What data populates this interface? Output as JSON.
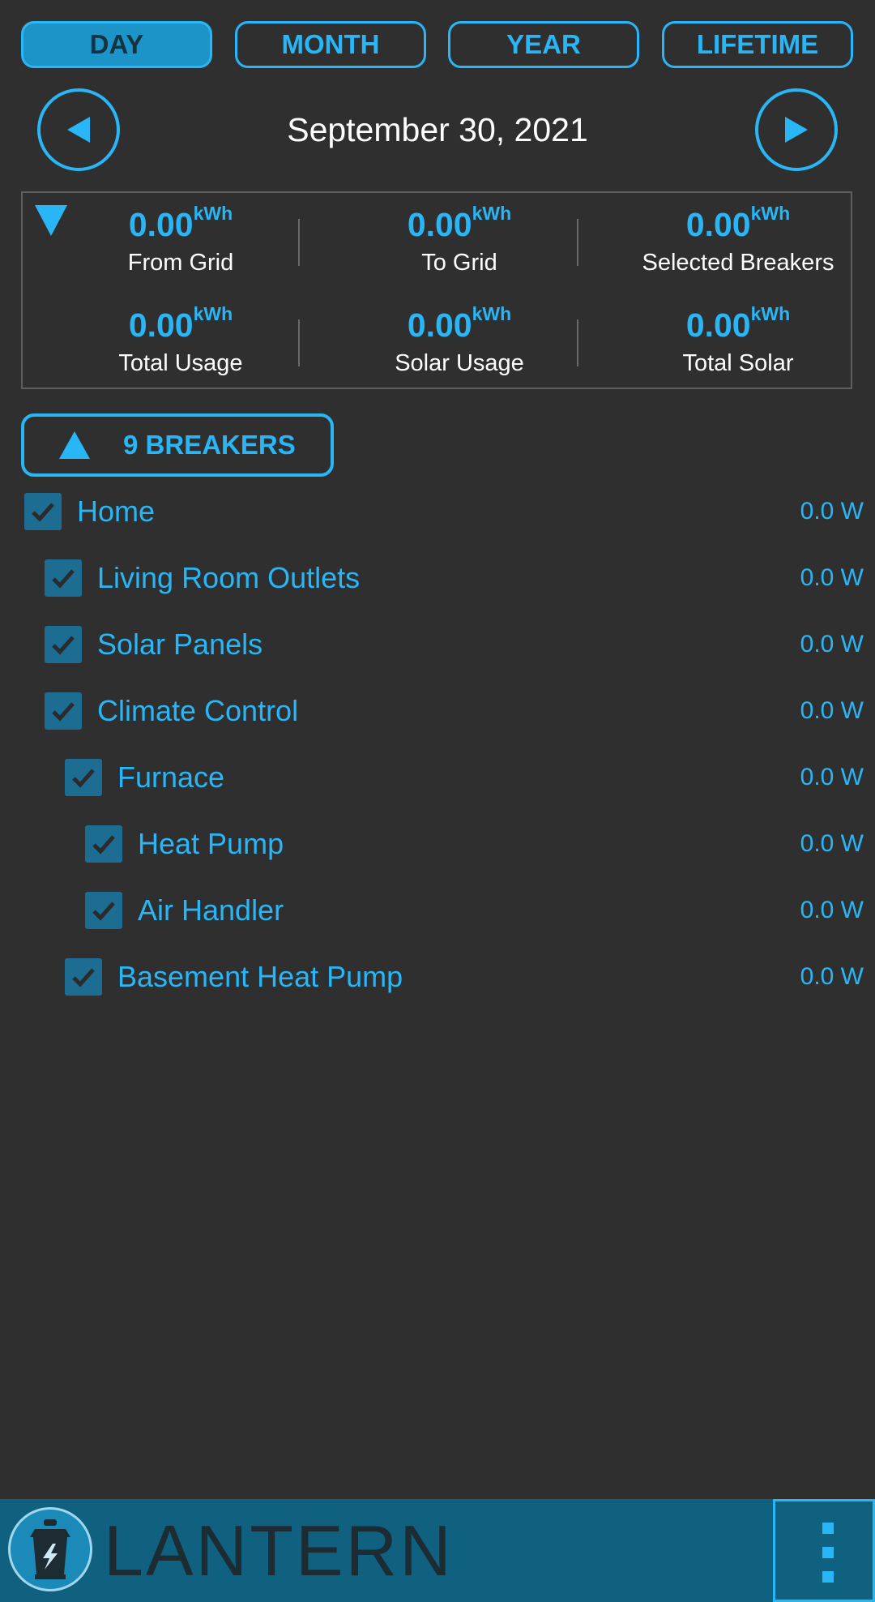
{
  "period_tabs": [
    {
      "label": "DAY",
      "active": true
    },
    {
      "label": "MONTH",
      "active": false
    },
    {
      "label": "YEAR",
      "active": false
    },
    {
      "label": "LIFETIME",
      "active": false
    }
  ],
  "date_nav": {
    "date": "September 30, 2021",
    "prev_icon": "left-triangle-icon",
    "next_icon": "right-triangle-icon"
  },
  "summary": {
    "unit": "kWh",
    "stats": [
      {
        "value": "0.00",
        "label": "From Grid"
      },
      {
        "value": "0.00",
        "label": "To Grid"
      },
      {
        "value": "0.00",
        "label": "Selected Breakers"
      },
      {
        "value": "0.00",
        "label": "Total Usage"
      },
      {
        "value": "0.00",
        "label": "Solar Usage"
      },
      {
        "value": "0.00",
        "label": "Total Solar"
      }
    ]
  },
  "breakers_toggle": {
    "label": "9 BREAKERS"
  },
  "breakers": [
    {
      "name": "Home",
      "watts": "0.0 W",
      "checked": true,
      "level": 0
    },
    {
      "name": "Living Room Outlets",
      "watts": "0.0 W",
      "checked": true,
      "level": 1
    },
    {
      "name": "Solar Panels",
      "watts": "0.0 W",
      "checked": true,
      "level": 1
    },
    {
      "name": "Climate Control",
      "watts": "0.0 W",
      "checked": true,
      "level": 1
    },
    {
      "name": "Furnace",
      "watts": "0.0 W",
      "checked": true,
      "level": 2
    },
    {
      "name": "Heat Pump",
      "watts": "0.0 W",
      "checked": true,
      "level": 3
    },
    {
      "name": "Air Handler",
      "watts": "0.0 W",
      "checked": true,
      "level": 3
    },
    {
      "name": "Basement Heat Pump",
      "watts": "0.0 W",
      "checked": true,
      "level": 2
    }
  ],
  "bottom_bar": {
    "brand": "LANTERN",
    "logo_icon": "lantern-lightning-icon",
    "menu_icon": "more-vertical-icon"
  },
  "colors": {
    "accent": "#29b6f6",
    "background": "#2f2f2f",
    "bar": "#10617f",
    "checkbox": "#1d6d92"
  }
}
